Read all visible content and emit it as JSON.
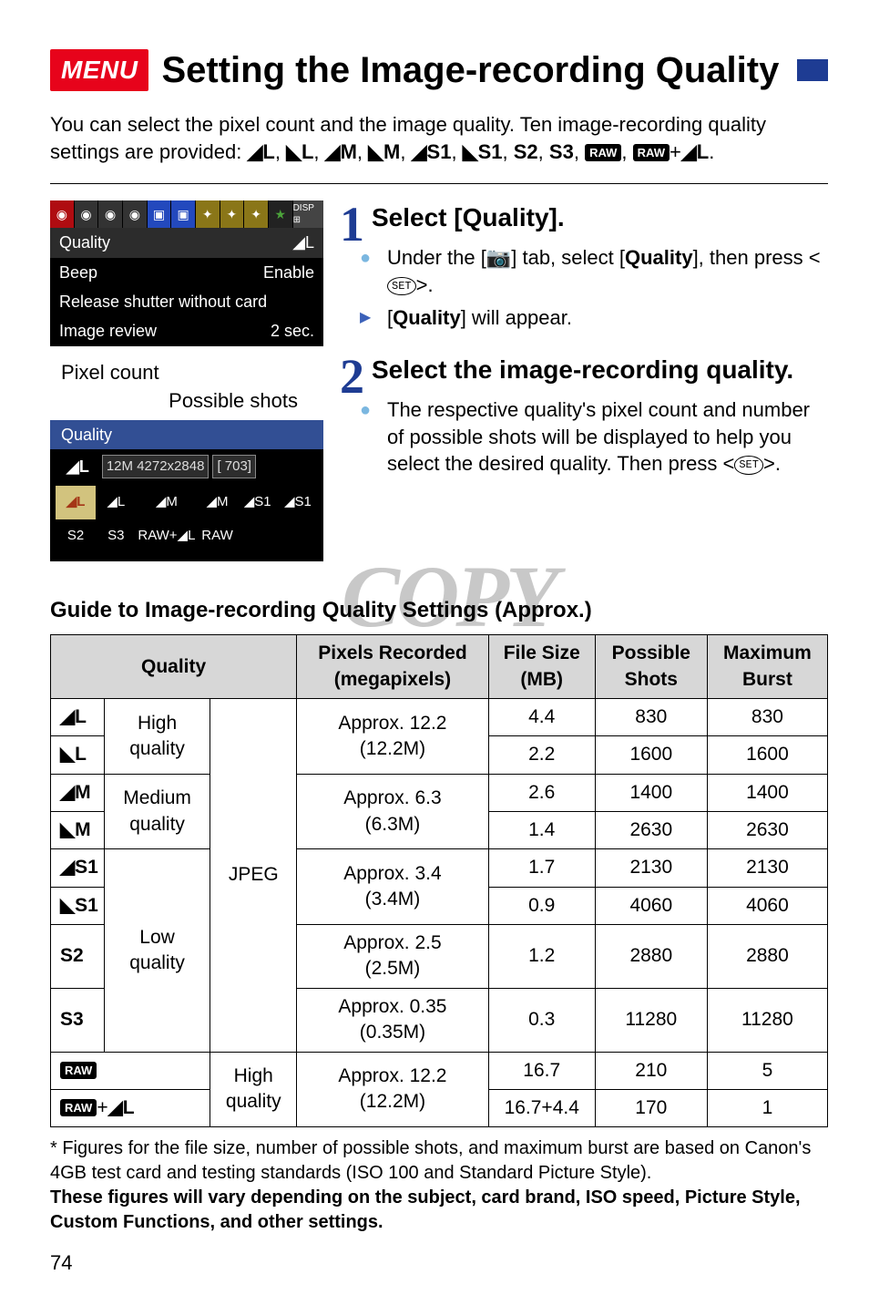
{
  "header": {
    "badge": "MENU",
    "title": "Setting the Image-recording Quality"
  },
  "intro": {
    "line1": "You can select the pixel count and the image quality. Ten image-recording quality settings are provided: ◢L, ◢L, ◢M, ◢M, ◢S1, ◢S1, S2, S3, RAW, RAW+◢L."
  },
  "cam_menu": {
    "rows": [
      {
        "label": "Quality",
        "value": "◢L",
        "selected": true
      },
      {
        "label": "Beep",
        "value": "Enable",
        "selected": false
      },
      {
        "label": "Release shutter without card",
        "value": "",
        "selected": false
      },
      {
        "label": "Image review",
        "value": "2 sec.",
        "selected": false
      }
    ]
  },
  "labels": {
    "pixel_count": "Pixel count",
    "possible_shots": "Possible shots"
  },
  "cam_quality": {
    "header": "Quality",
    "current_icon": "◢L",
    "info": "12M 4272x2848",
    "shots": "[ 703]",
    "grid": [
      "◢L",
      "◢L",
      "◢M",
      "◢M",
      "◢S1",
      "◢S1",
      "S2",
      "S3",
      "RAW+◢L",
      "RAW",
      "",
      ""
    ]
  },
  "steps": [
    {
      "num": "1",
      "title": "Select [Quality].",
      "bullets": [
        {
          "type": "dot",
          "html": "Under the [📷] tab, select [<b>Quality</b>], then press <SET>."
        },
        {
          "type": "tri",
          "html": "[<b>Quality</b>] will appear."
        }
      ]
    },
    {
      "num": "2",
      "title": "Select the image-recording quality.",
      "bullets": [
        {
          "type": "dot",
          "html": "The respective quality's pixel count and number of possible shots will be displayed to help you select the desired quality. Then press <SET>."
        }
      ]
    }
  ],
  "guide_title": "Guide to Image-recording Quality Settings (Approx.)",
  "table": {
    "headers": [
      "Quality",
      "Pixels Recorded (megapixels)",
      "File Size (MB)",
      "Possible Shots",
      "Maximum Burst"
    ]
  },
  "chart_data": {
    "type": "table",
    "title": "Guide to Image-recording Quality Settings (Approx.)",
    "columns": [
      "Quality Icon",
      "Quality Group",
      "Format",
      "Pixels Recorded (megapixels)",
      "File Size (MB)",
      "Possible Shots",
      "Maximum Burst"
    ],
    "rows": [
      {
        "icon": "◢L (fine)",
        "group": "High quality",
        "format": "JPEG",
        "pixels": "Approx. 12.2 (12.2M)",
        "filesize": "4.4",
        "shots": "830",
        "burst": "830"
      },
      {
        "icon": "◢L (normal)",
        "group": "High quality",
        "format": "JPEG",
        "pixels": "Approx. 12.2 (12.2M)",
        "filesize": "2.2",
        "shots": "1600",
        "burst": "1600"
      },
      {
        "icon": "◢M (fine)",
        "group": "Medium quality",
        "format": "JPEG",
        "pixels": "Approx. 6.3 (6.3M)",
        "filesize": "2.6",
        "shots": "1400",
        "burst": "1400"
      },
      {
        "icon": "◢M (normal)",
        "group": "Medium quality",
        "format": "JPEG",
        "pixels": "Approx. 6.3 (6.3M)",
        "filesize": "1.4",
        "shots": "2630",
        "burst": "2630"
      },
      {
        "icon": "◢S1 (fine)",
        "group": "Low quality",
        "format": "JPEG",
        "pixels": "Approx. 3.4 (3.4M)",
        "filesize": "1.7",
        "shots": "2130",
        "burst": "2130"
      },
      {
        "icon": "◢S1 (normal)",
        "group": "Low quality",
        "format": "JPEG",
        "pixels": "Approx. 3.4 (3.4M)",
        "filesize": "0.9",
        "shots": "4060",
        "burst": "4060"
      },
      {
        "icon": "S2",
        "group": "Low quality",
        "format": "JPEG",
        "pixels": "Approx. 2.5 (2.5M)",
        "filesize": "1.2",
        "shots": "2880",
        "burst": "2880"
      },
      {
        "icon": "S3",
        "group": "Low quality",
        "format": "JPEG",
        "pixels": "Approx. 0.35 (0.35M)",
        "filesize": "0.3",
        "shots": "11280",
        "burst": "11280"
      },
      {
        "icon": "RAW",
        "group": "High quality",
        "format": "RAW",
        "pixels": "Approx. 12.2 (12.2M)",
        "filesize": "16.7",
        "shots": "210",
        "burst": "5"
      },
      {
        "icon": "RAW+◢L",
        "group": "High quality",
        "format": "RAW",
        "pixels": "Approx. 12.2 (12.2M)",
        "filesize": "16.7+4.4",
        "shots": "170",
        "burst": "1"
      }
    ]
  },
  "footnote": {
    "prefix": "* Figures for the file size, number of possible shots, and maximum burst are based on Canon's 4GB test card and testing standards (ISO 100 and Standard Picture Style).",
    "bold": "These figures will vary depending on the subject, card brand, ISO speed, Picture Style, Custom Functions, and other settings."
  },
  "page_number": "74"
}
